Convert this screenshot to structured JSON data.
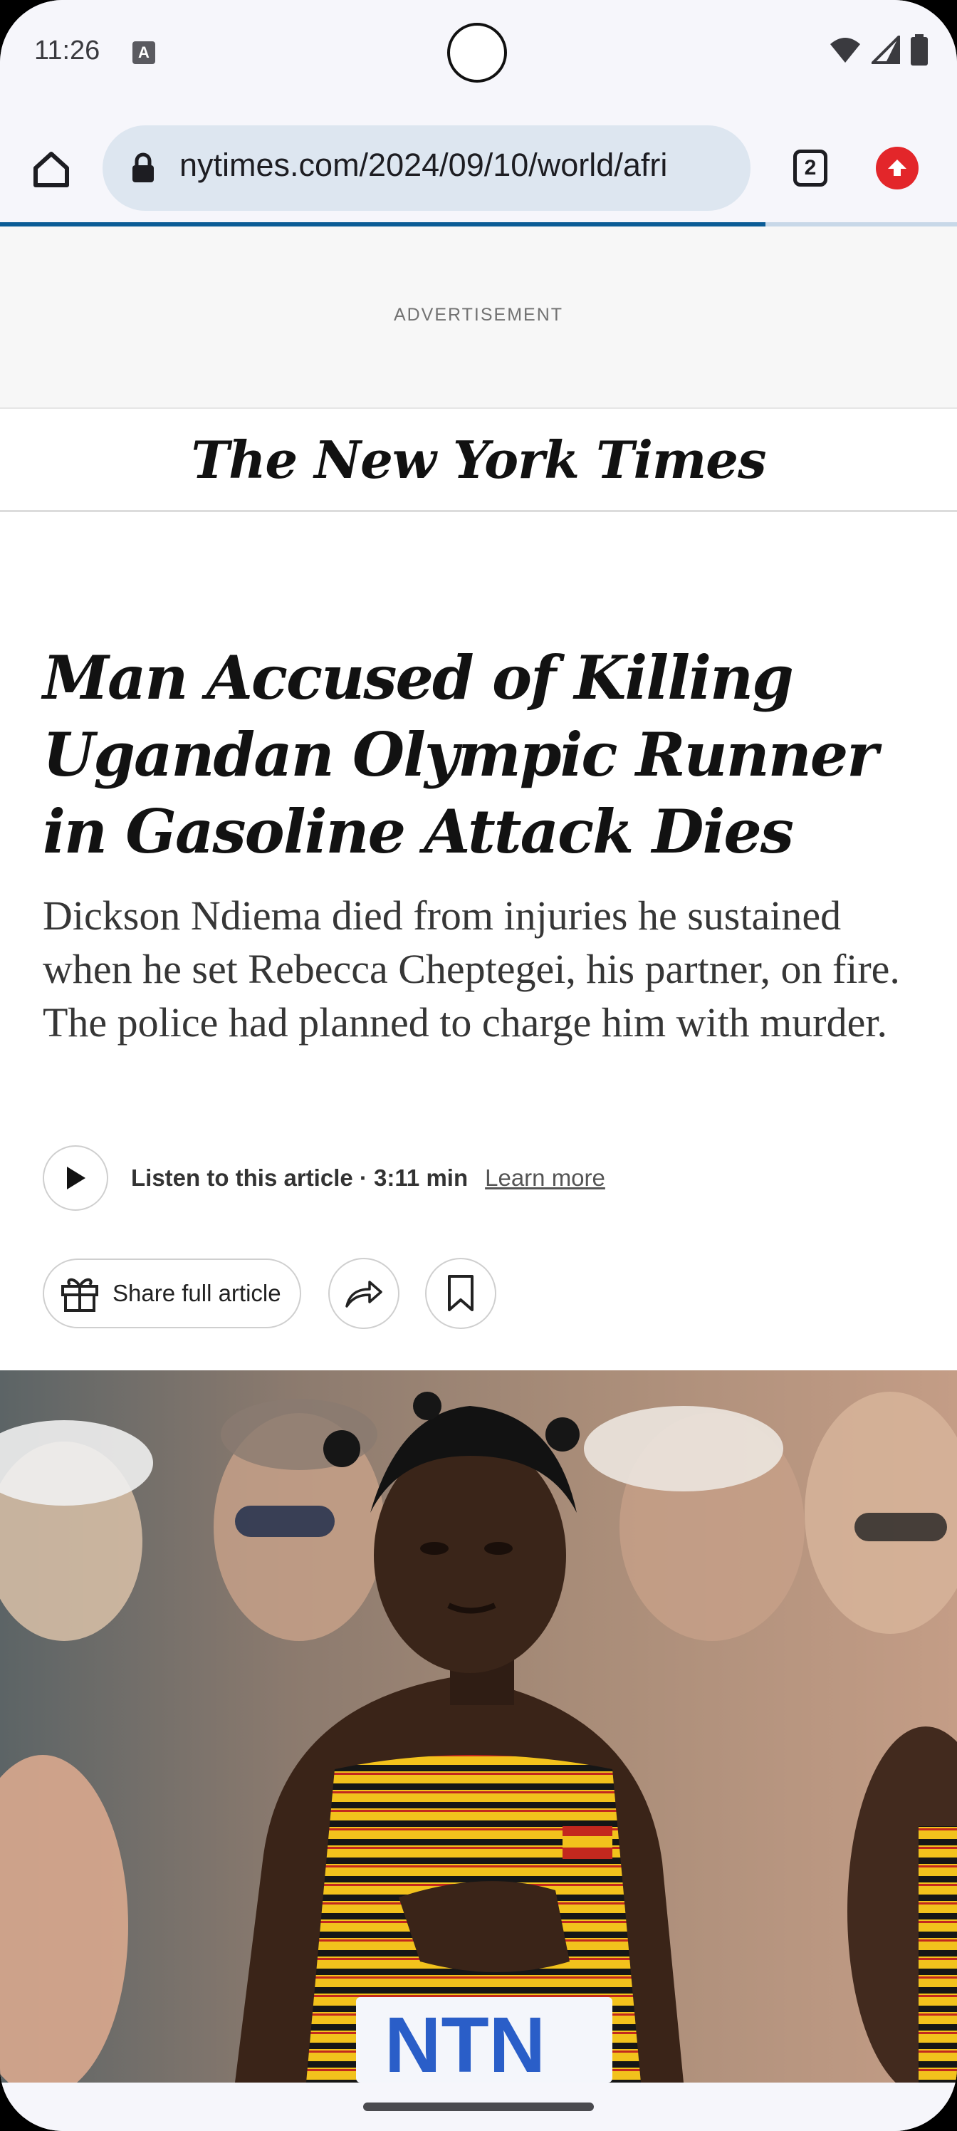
{
  "status_bar": {
    "time": "11:26",
    "notification_icon": "A",
    "icons": [
      "wifi-icon",
      "signal-icon",
      "battery-icon"
    ]
  },
  "browser": {
    "url": "nytimes.com/2024/09/10/world/afri",
    "tab_count": "2",
    "load_progress_percent": 80
  },
  "ad": {
    "label": "ADVERTISEMENT"
  },
  "masthead": {
    "logo_text": "The New York Times"
  },
  "article": {
    "headline": "Man Accused of Killing Ugandan Olympic Runner in Gasoline Attack Dies",
    "summary": "Dickson Ndiema died from injuries he sustained when he set Rebecca Cheptegei, his partner, on fire. The police had planned to charge him with murder.",
    "listen_label": "Listen to this article · 3:11 min",
    "learn_more": "Learn more",
    "share_full_label": "Share full article"
  },
  "photo": {
    "accent_yellow": "#f2c21c",
    "accent_black": "#161616"
  },
  "colors": {
    "progress": "#0b5c96",
    "update_badge": "#e3262a"
  }
}
